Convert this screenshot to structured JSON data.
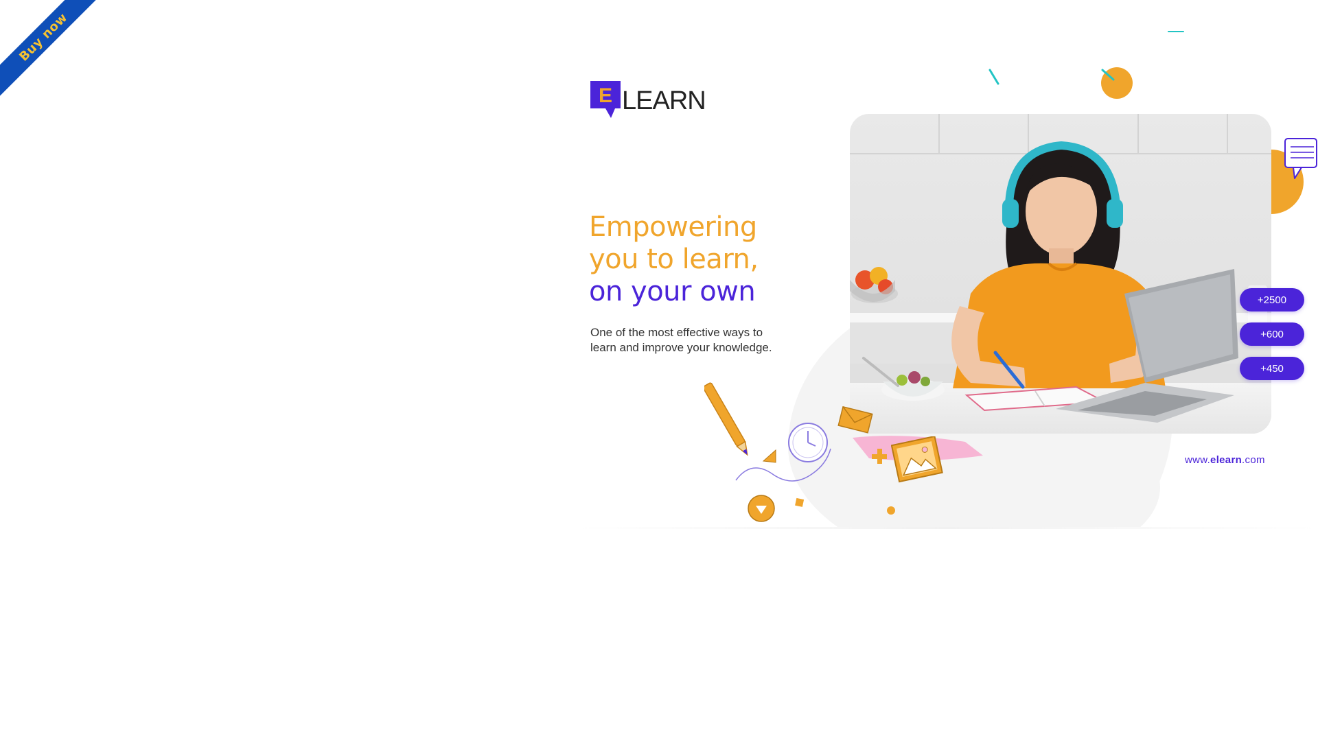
{
  "ribbon": {
    "label": "Buy now"
  },
  "brand": {
    "mark_letter": "E",
    "wordmark": "LEARN"
  },
  "hero": {
    "headline_line1": "Empowering",
    "headline_line2": "you to learn,",
    "headline_line3": "on your own",
    "subtext_line1": "One of the most effective ways to",
    "subtext_line2": "learn and improve your knowledge."
  },
  "stats": [
    "+2500",
    "+600",
    "+450"
  ],
  "website": {
    "prefix": "www.",
    "domain": "elearn",
    "suffix": ".com"
  },
  "colors": {
    "accent": "#4b24d9",
    "secondary": "#f0a52c",
    "ribbon": "#0f4fb8"
  }
}
